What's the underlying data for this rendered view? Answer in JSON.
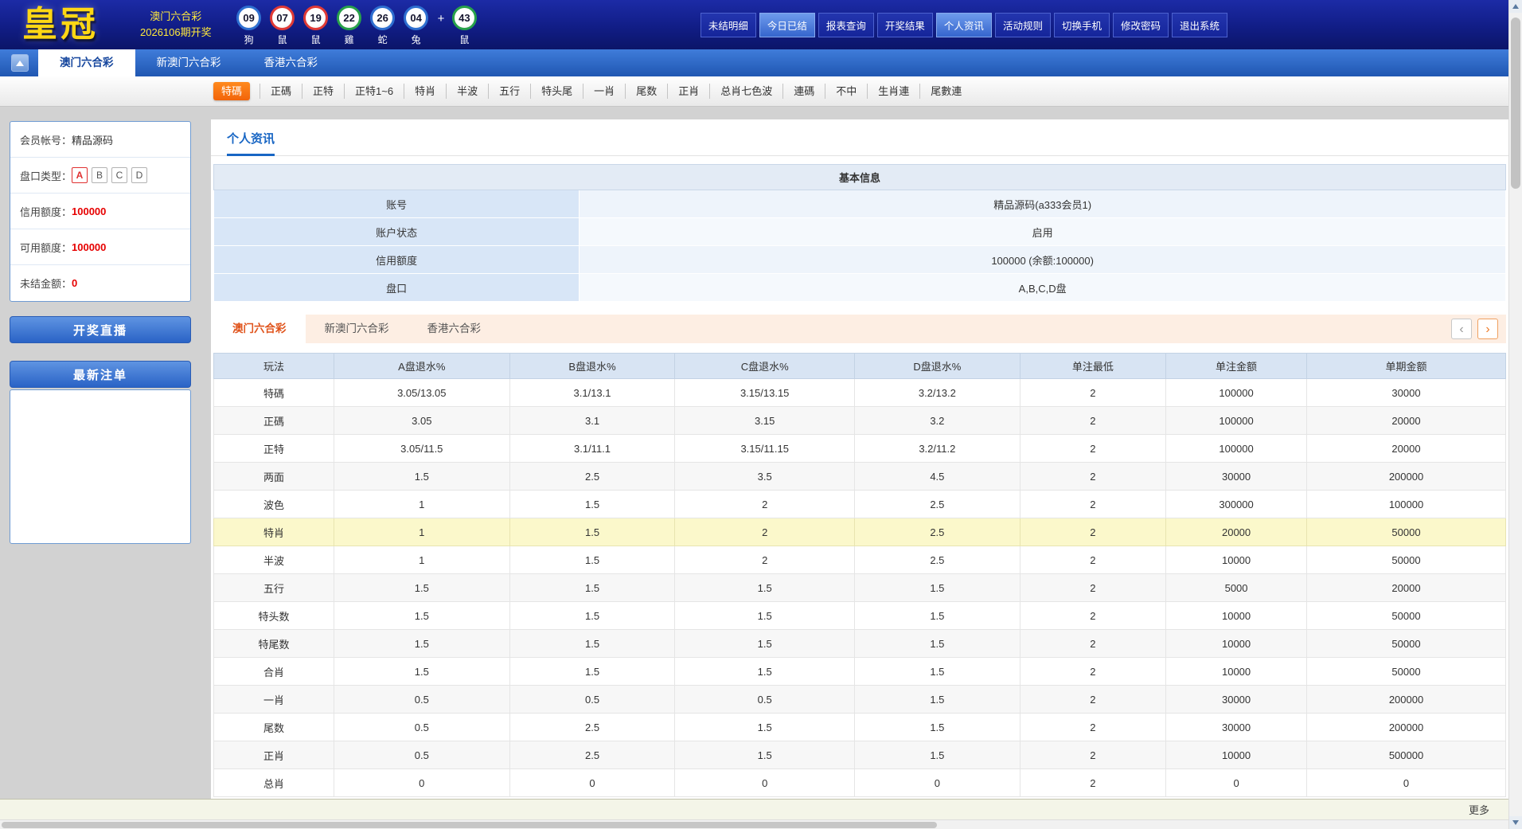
{
  "header": {
    "logo": "皇冠",
    "lottery_name": "澳门六合彩",
    "draw_issue": "2026106期开奖",
    "plus": "+",
    "balls": [
      {
        "num": "09",
        "zodiac": "狗",
        "color": "#2e6fd0"
      },
      {
        "num": "07",
        "zodiac": "鼠",
        "color": "#e03a36"
      },
      {
        "num": "19",
        "zodiac": "鼠",
        "color": "#e03a36"
      },
      {
        "num": "22",
        "zodiac": "雞",
        "color": "#28a14a"
      },
      {
        "num": "26",
        "zodiac": "蛇",
        "color": "#2e6fd0"
      },
      {
        "num": "04",
        "zodiac": "兔",
        "color": "#2e6fd0"
      },
      {
        "num": "43",
        "zodiac": "鼠",
        "color": "#28a14a"
      }
    ],
    "menu": [
      {
        "label": "未结明细",
        "active": false
      },
      {
        "label": "今日已结",
        "active": true
      },
      {
        "label": "报表查询",
        "active": false
      },
      {
        "label": "开奖结果",
        "active": false
      },
      {
        "label": "个人资讯",
        "active": true
      },
      {
        "label": "活动规则",
        "active": false
      },
      {
        "label": "切换手机",
        "active": false
      },
      {
        "label": "修改密码",
        "active": false
      },
      {
        "label": "退出系统",
        "active": false
      }
    ]
  },
  "main_tabs": [
    "澳门六合彩",
    "新澳门六合彩",
    "香港六合彩"
  ],
  "subnav": [
    "特碼",
    "正碼",
    "正特",
    "正特1~6",
    "特肖",
    "半波",
    "五行",
    "特头尾",
    "一肖",
    "尾数",
    "正肖",
    "总肖七色波",
    "連碼",
    "不中",
    "生肖連",
    "尾數連"
  ],
  "sidebar": {
    "account_label": "会员帐号：",
    "account_value": "精品源码",
    "panel_label": "盘口类型：",
    "panels": [
      "A",
      "B",
      "C",
      "D"
    ],
    "credit_label": "信用额度：",
    "credit_value": "100000",
    "available_label": "可用额度：",
    "available_value": "100000",
    "unsettled_label": "未结金额：",
    "unsettled_value": "0",
    "live_button": "开奖直播",
    "latest_orders": "最新注单"
  },
  "content": {
    "page_title": "个人资讯",
    "info_table": {
      "title": "基本信息",
      "rows": [
        {
          "label": "账号",
          "value": "精品源码(a333会员1)"
        },
        {
          "label": "账户状态",
          "value": "启用"
        },
        {
          "label": "信用额度",
          "value": "100000 (余额:100000)"
        },
        {
          "label": "盘口",
          "value": "A,B,C,D盘"
        }
      ]
    },
    "lottery_tabs": [
      "澳门六合彩",
      "新澳门六合彩",
      "香港六合彩"
    ],
    "pager": {
      "prev": "‹",
      "next": "›"
    },
    "odds_table": {
      "headers": [
        "玩法",
        "A盘退水%",
        "B盘退水%",
        "C盘退水%",
        "D盘退水%",
        "单注最低",
        "单注金额",
        "单期金额"
      ],
      "rows": [
        {
          "cells": [
            "特碼",
            "3.05/13.05",
            "3.1/13.1",
            "3.15/13.15",
            "3.2/13.2",
            "2",
            "100000",
            "30000"
          ],
          "highlight": false
        },
        {
          "cells": [
            "正碼",
            "3.05",
            "3.1",
            "3.15",
            "3.2",
            "2",
            "100000",
            "20000"
          ],
          "highlight": false
        },
        {
          "cells": [
            "正特",
            "3.05/11.5",
            "3.1/11.1",
            "3.15/11.15",
            "3.2/11.2",
            "2",
            "100000",
            "20000"
          ],
          "highlight": false
        },
        {
          "cells": [
            "两面",
            "1.5",
            "2.5",
            "3.5",
            "4.5",
            "2",
            "30000",
            "200000"
          ],
          "highlight": false
        },
        {
          "cells": [
            "波色",
            "1",
            "1.5",
            "2",
            "2.5",
            "2",
            "300000",
            "100000"
          ],
          "highlight": false
        },
        {
          "cells": [
            "特肖",
            "1",
            "1.5",
            "2",
            "2.5",
            "2",
            "20000",
            "50000"
          ],
          "highlight": true
        },
        {
          "cells": [
            "半波",
            "1",
            "1.5",
            "2",
            "2.5",
            "2",
            "10000",
            "50000"
          ],
          "highlight": false
        },
        {
          "cells": [
            "五行",
            "1.5",
            "1.5",
            "1.5",
            "1.5",
            "2",
            "5000",
            "20000"
          ],
          "highlight": false
        },
        {
          "cells": [
            "特头数",
            "1.5",
            "1.5",
            "1.5",
            "1.5",
            "2",
            "10000",
            "50000"
          ],
          "highlight": false
        },
        {
          "cells": [
            "特尾数",
            "1.5",
            "1.5",
            "1.5",
            "1.5",
            "2",
            "10000",
            "50000"
          ],
          "highlight": false
        },
        {
          "cells": [
            "合肖",
            "1.5",
            "1.5",
            "1.5",
            "1.5",
            "2",
            "10000",
            "50000"
          ],
          "highlight": false
        },
        {
          "cells": [
            "一肖",
            "0.5",
            "0.5",
            "0.5",
            "1.5",
            "2",
            "30000",
            "200000"
          ],
          "highlight": false
        },
        {
          "cells": [
            "尾数",
            "0.5",
            "2.5",
            "1.5",
            "1.5",
            "2",
            "30000",
            "200000"
          ],
          "highlight": false
        },
        {
          "cells": [
            "正肖",
            "0.5",
            "2.5",
            "1.5",
            "1.5",
            "2",
            "10000",
            "500000"
          ],
          "highlight": false
        },
        {
          "cells": [
            "总肖",
            "0",
            "0",
            "0",
            "0",
            "2",
            "0",
            "0"
          ],
          "highlight": false
        }
      ]
    },
    "more_link": "更多"
  },
  "colors": {
    "accent_blue": "#2a63c6",
    "accent_orange": "#f2640a",
    "highlight_row": "#fbf8cb",
    "value_red": "#e60000"
  }
}
